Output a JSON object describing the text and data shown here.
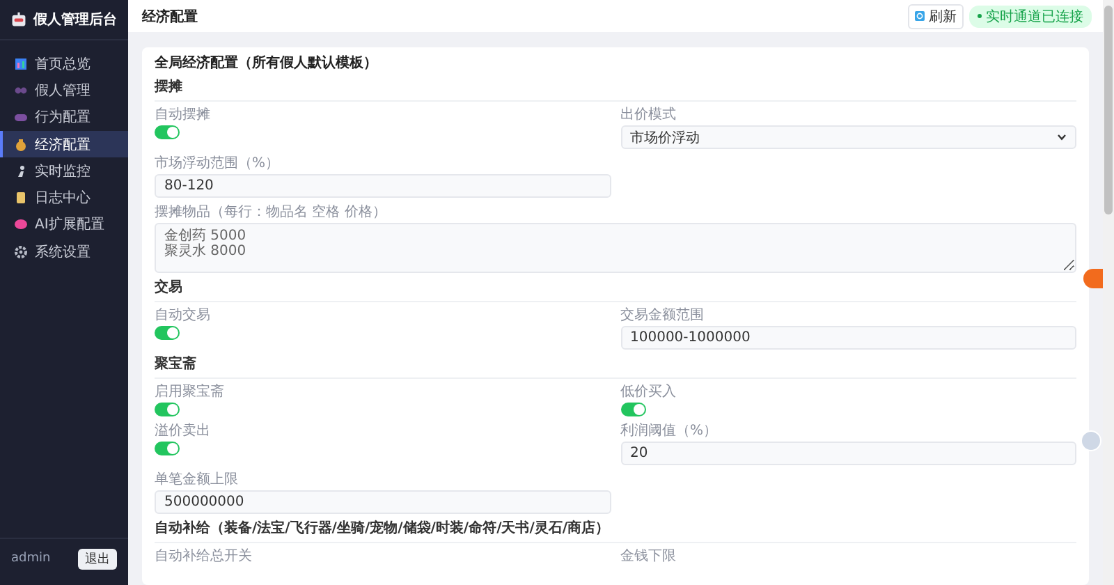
{
  "sidebar": {
    "title": "假人管理后台",
    "items": [
      {
        "label": "首页总览",
        "selected": false
      },
      {
        "label": "假人管理",
        "selected": false
      },
      {
        "label": "行为配置",
        "selected": false
      },
      {
        "label": "经济配置",
        "selected": true
      },
      {
        "label": "实时监控",
        "selected": false
      },
      {
        "label": "日志中心",
        "selected": false
      },
      {
        "label": "AI扩展配置",
        "selected": false
      },
      {
        "label": "系统设置",
        "selected": false
      }
    ],
    "user": "admin",
    "logout": "退出"
  },
  "header": {
    "title": "经济配置",
    "refresh": "刷新",
    "status": "实时通道已连接"
  },
  "card": {
    "title": "全局经济配置（所有假人默认模板）",
    "sections": [
      {
        "title": "摆摊",
        "rows": [
          [
            {
              "kind": "toggle",
              "label": "自动摆摊",
              "on": true
            },
            {
              "kind": "select",
              "label": "出价模式",
              "value": "市场价浮动"
            }
          ],
          [
            {
              "kind": "input",
              "label": "市场浮动范围（%）",
              "value": "80-120"
            }
          ],
          [
            {
              "kind": "textarea",
              "label": "摆摊物品（每行：物品名 空格 价格）",
              "value": "金创药 5000\n聚灵水 8000"
            }
          ]
        ]
      },
      {
        "title": "交易",
        "rows": [
          [
            {
              "kind": "toggle",
              "label": "自动交易",
              "on": true
            },
            {
              "kind": "input",
              "label": "交易金额范围",
              "value": "100000-1000000"
            }
          ]
        ]
      },
      {
        "title": "聚宝斋",
        "rows": [
          [
            {
              "kind": "toggle",
              "label": "启用聚宝斋",
              "on": true
            },
            {
              "kind": "toggle",
              "label": "低价买入",
              "on": true
            }
          ],
          [
            {
              "kind": "toggle",
              "label": "溢价卖出",
              "on": true
            },
            {
              "kind": "input",
              "label": "利润阈值（%）",
              "value": "20"
            }
          ],
          [
            {
              "kind": "input",
              "label": "单笔金额上限",
              "value": "500000000"
            }
          ]
        ]
      },
      {
        "title": "自动补给（装备/法宝/飞行器/坐骑/宠物/储袋/时装/命符/天书/灵石/商店）",
        "rows": [
          [
            {
              "kind": "label",
              "label": "自动补给总开关"
            },
            {
              "kind": "label",
              "label": "金钱下限"
            }
          ]
        ]
      }
    ]
  }
}
